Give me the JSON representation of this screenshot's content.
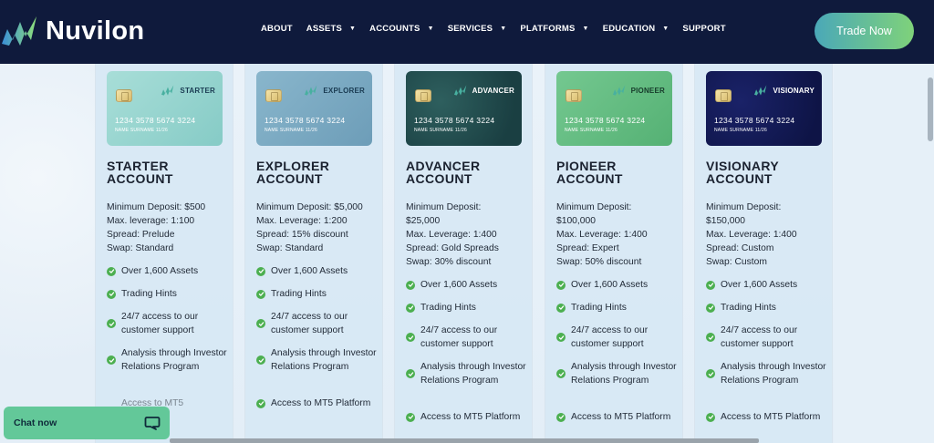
{
  "header": {
    "brand": "Nuvilon",
    "nav": [
      {
        "label": "ABOUT",
        "dropdown": false
      },
      {
        "label": "ASSETS",
        "dropdown": true
      },
      {
        "label": "ACCOUNTS",
        "dropdown": true
      },
      {
        "label": "SERVICES",
        "dropdown": true
      },
      {
        "label": "PLATFORMS",
        "dropdown": true
      },
      {
        "label": "EDUCATION",
        "dropdown": true
      },
      {
        "label": "SUPPORT",
        "dropdown": false
      }
    ],
    "trade_button": "Trade Now"
  },
  "colors": {
    "header_bg": "#0f1a3c",
    "check": "#4caf50",
    "chat_bg": "#63c899"
  },
  "accounts": [
    {
      "card_brand": "STARTER",
      "card_number": "1234 3578 5674 3224",
      "card_holder": "NAME SURNAME 11/26",
      "title": "STARTER ACCOUNT",
      "specs": [
        "Minimum Deposit: $500",
        "Max. leverage: 1:100",
        "Spread: Prelude",
        "Swap: Standard"
      ],
      "features": [
        "Over 1,600 Assets",
        "Trading Hints",
        "24/7 access to our customer support",
        "Analysis through Investor Relations Program",
        "Access to MT5"
      ]
    },
    {
      "card_brand": "EXPLORER",
      "card_number": "1234 3578 5674 3224",
      "card_holder": "NAME SURNAME 11/26",
      "title": "EXPLORER ACCOUNT",
      "specs": [
        "Minimum Deposit: $5,000",
        "Max. Leverage: 1:200",
        "Spread: 15% discount",
        "Swap: Standard"
      ],
      "features": [
        "Over 1,600 Assets",
        "Trading Hints",
        "24/7 access to our customer support",
        "Analysis through Investor Relations Program",
        "Access to MT5 Platform"
      ]
    },
    {
      "card_brand": "ADVANCER",
      "card_number": "1234 3578 5674 3224",
      "card_holder": "NAME SURNAME 11/26",
      "title": "ADVANCER ACCOUNT",
      "specs": [
        "Minimum Deposit:",
        "$25,000",
        "Max. Leverage: 1:400",
        "Spread: Gold Spreads",
        "Swap: 30% discount"
      ],
      "features": [
        "Over 1,600 Assets",
        "Trading Hints",
        "24/7 access to our customer support",
        "Analysis through Investor Relations Program",
        "Access to MT5 Platform"
      ]
    },
    {
      "card_brand": "PIONEER",
      "card_number": "1234 3578 5674 3224",
      "card_holder": "NAME SURNAME 11/26",
      "title": "PIONEER ACCOUNT",
      "specs": [
        "Minimum Deposit:",
        "$100,000",
        "Max. Leverage: 1:400",
        "Spread: Expert",
        "Swap: 50% discount"
      ],
      "features": [
        "Over 1,600 Assets",
        "Trading Hints",
        "24/7 access to our customer support",
        "Analysis through Investor Relations Program",
        "Access to MT5 Platform"
      ]
    },
    {
      "card_brand": "VISIONARY",
      "card_number": "1234 3578 5674 3224",
      "card_holder": "NAME SURNAME 11/26",
      "title": "VISIONARY ACCOUNT",
      "specs": [
        "Minimum Deposit:",
        "$150,000",
        "Max. Leverage: 1:400",
        "Spread: Custom",
        "Swap: Custom"
      ],
      "features": [
        "Over 1,600 Assets",
        "Trading Hints",
        "24/7 access to our customer support",
        "Analysis through Investor Relations Program",
        "Access to MT5 Platform"
      ]
    }
  ],
  "chat": {
    "label": "Chat now"
  }
}
